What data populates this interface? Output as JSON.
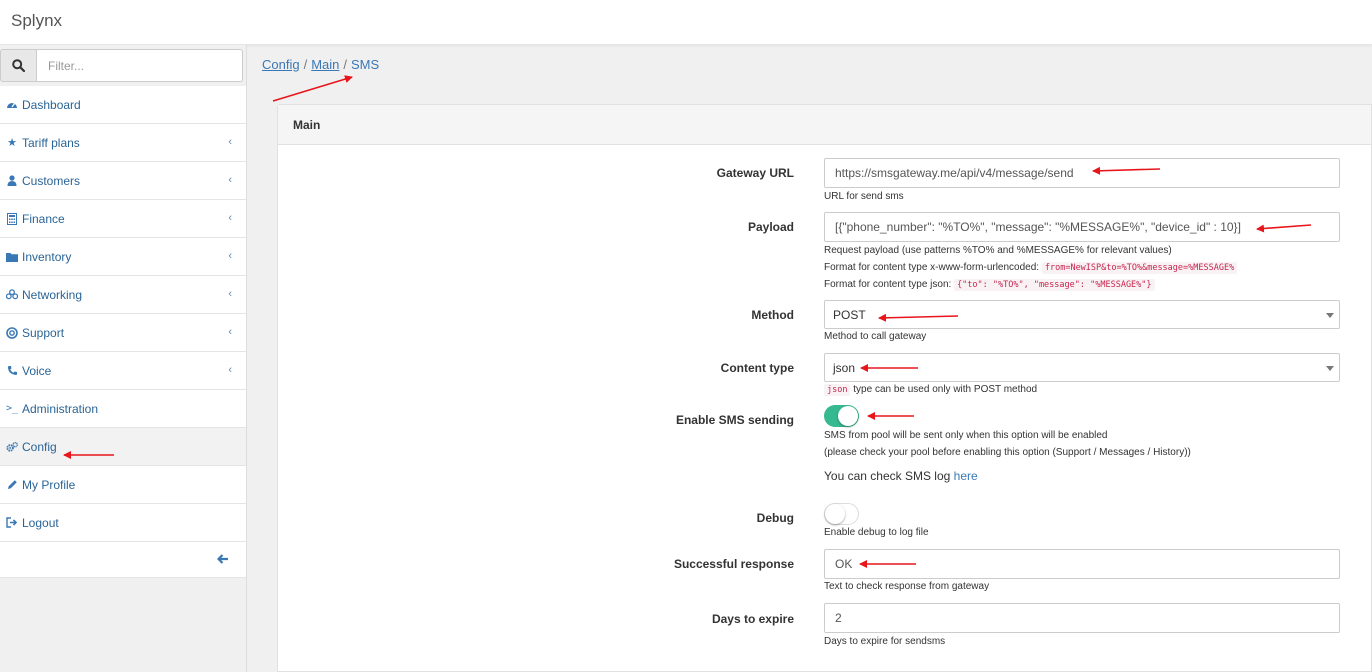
{
  "app": {
    "title": "Splynx"
  },
  "search": {
    "placeholder": "Filter..."
  },
  "sidebar": {
    "items": [
      {
        "label": "Dashboard",
        "icon": "dashboard-icon",
        "chevron": false
      },
      {
        "label": "Tariff plans",
        "icon": "star-icon",
        "chevron": true
      },
      {
        "label": "Customers",
        "icon": "user-icon",
        "chevron": true
      },
      {
        "label": "Finance",
        "icon": "calculator-icon",
        "chevron": true
      },
      {
        "label": "Inventory",
        "icon": "folder-icon",
        "chevron": true
      },
      {
        "label": "Networking",
        "icon": "network-icon",
        "chevron": true
      },
      {
        "label": "Support",
        "icon": "lifebuoy-icon",
        "chevron": true
      },
      {
        "label": "Voice",
        "icon": "phone-icon",
        "chevron": true
      },
      {
        "label": "Administration",
        "icon": "terminal-icon",
        "chevron": false
      },
      {
        "label": "Config",
        "icon": "gears-icon",
        "chevron": false,
        "active": true
      },
      {
        "label": "My Profile",
        "icon": "pencil-icon",
        "chevron": false
      },
      {
        "label": "Logout",
        "icon": "logout-icon",
        "chevron": false
      }
    ]
  },
  "breadcrumb": {
    "items": [
      "Config",
      "Main"
    ],
    "current": "SMS"
  },
  "panel": {
    "title": "Main"
  },
  "form": {
    "gateway_url": {
      "label": "Gateway URL",
      "value": "https://smsgateway.me/api/v4/message/send",
      "help": "URL for send sms"
    },
    "payload": {
      "label": "Payload",
      "value": "[{\"phone_number\": \"%TO%\", \"message\": \"%MESSAGE%\", \"device_id\" : 10}]",
      "help1": "Request payload (use patterns %TO% and %MESSAGE% for relevant values)",
      "help2_prefix": "Format for content type x-www-form-urlencoded:",
      "help2_code": "from=NewISP&to=%TO%&message=%MESSAGE%",
      "help3_prefix": "Format for content type json:",
      "help3_code": "{\"to\": \"%TO%\", \"message\": \"%MESSAGE%\"}"
    },
    "method": {
      "label": "Method",
      "value": "POST",
      "help": "Method to call gateway"
    },
    "content_type": {
      "label": "Content type",
      "value": "json",
      "help_code": "json",
      "help": "type can be used only with POST method"
    },
    "enable_sms": {
      "label": "Enable SMS sending",
      "enabled": true,
      "help1": "SMS from pool will be sent only when this option will be enabled",
      "help2": "(please check your pool before enabling this option (Support / Messages / History))"
    },
    "sms_log": {
      "text": "You can check SMS log",
      "link": "here"
    },
    "debug": {
      "label": "Debug",
      "enabled": false,
      "help": "Enable debug to log file"
    },
    "success_response": {
      "label": "Successful response",
      "value": "OK",
      "help": "Text to check response from gateway"
    },
    "days_expire": {
      "label": "Days to expire",
      "value": "2",
      "help": "Days to expire for sendsms"
    }
  },
  "colors": {
    "accent": "#3a78b5",
    "toggle_on": "#34b991",
    "annotation": "#e8151b",
    "code_text": "#c7254e"
  }
}
